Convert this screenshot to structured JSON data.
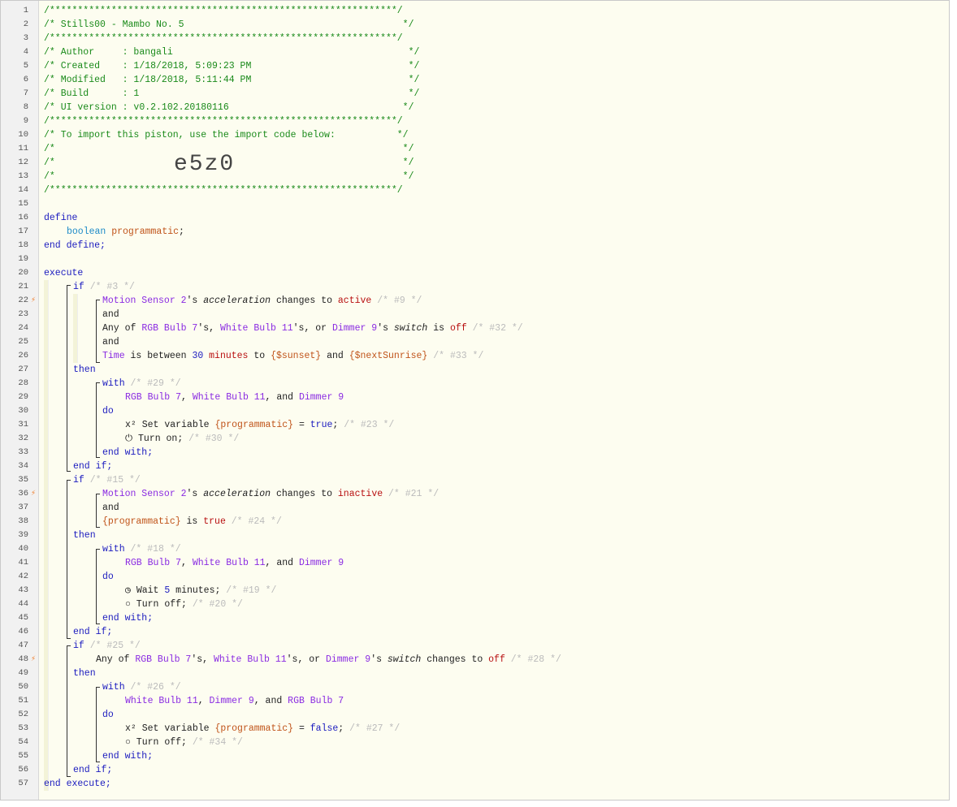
{
  "gutter": {
    "line_numbers": [
      "1",
      "2",
      "3",
      "4",
      "5",
      "6",
      "7",
      "8",
      "9",
      "10",
      "11",
      "12",
      "13",
      "14",
      "15",
      "16",
      "17",
      "18",
      "19",
      "20",
      "21",
      "22",
      "23",
      "24",
      "25",
      "26",
      "27",
      "28",
      "29",
      "30",
      "31",
      "32",
      "33",
      "34",
      "35",
      "36",
      "37",
      "38",
      "39",
      "40",
      "41",
      "42",
      "43",
      "44",
      "45",
      "46",
      "47",
      "48",
      "49",
      "50",
      "51",
      "52",
      "53",
      "54",
      "55",
      "56",
      "57"
    ],
    "trigger_icon": "⚡",
    "trigger_lines": [
      "22",
      "36",
      "48"
    ]
  },
  "header": {
    "border": "/**************************************************************/",
    "title_line": "/* Stills00 - Mambo No. 5                                       */",
    "author_line": "/* Author     : bangali                                          */",
    "created_line": "/* Created    : 1/18/2018, 5:09:23 PM                            */",
    "modified_line": "/* Modified   : 1/18/2018, 5:11:44 PM                            */",
    "build_line": "/* Build      : 1                                                */",
    "ui_version_line": "/* UI version : v0.2.102.20180116                               */",
    "import_line": "/* To import this piston, use the import code below:           */",
    "empty_line": "/*                                                              */",
    "import_code": "e5z0"
  },
  "code": {
    "define": "define",
    "boolean": "boolean",
    "programmatic": "programmatic",
    "semicolon": ";",
    "end_define": "end define;",
    "execute": "execute",
    "end_execute": "end execute;",
    "if": "if",
    "then": "then",
    "and": "and",
    "with": "with",
    "do": "do",
    "end_with": "end with;",
    "end_if": "end if;",
    "block1": {
      "if_comment": "/* #3 */",
      "c1_device": "Motion Sensor 2",
      "c1_s": "'s ",
      "c1_attr": "acceleration",
      "c1_op": " changes to ",
      "c1_val": "active",
      "c1_comment": "/* #9 */",
      "c2_any": "Any of ",
      "c2_d1": "RGB Bulb 7",
      "c2_s1": "'s, ",
      "c2_d2": "White Bulb 11",
      "c2_s2": "'s, or ",
      "c2_d3": "Dimmer 9",
      "c2_s3": "'s ",
      "c2_attr": "switch",
      "c2_op": " is ",
      "c2_val": "off",
      "c2_comment": "/* #32 */",
      "c3_time": "Time",
      "c3_op": " is between ",
      "c3_num": "30",
      "c3_units": " minutes",
      "c3_to": " to ",
      "c3_v1": "{$sunset}",
      "c3_and": " and ",
      "c3_v2": "{$nextSunrise}",
      "c3_comment": "/* #33 */",
      "with_comment": "/* #29 */",
      "dev1": "RGB Bulb 7",
      "sep1": ", ",
      "dev2": "White Bulb 11",
      "sep2": ", and ",
      "dev3": "Dimmer 9",
      "a1_icon": "x²",
      "a1_text": " Set variable ",
      "a1_var": "{programmatic}",
      "a1_eq": " = ",
      "a1_val": "true",
      "a1_semi": ";",
      "a1_comment": "/* #23 */",
      "a2_icon": "⏻",
      "a2_text": " Turn on;",
      "a2_comment": "/* #30 */"
    },
    "block2": {
      "if_comment": "/* #15 */",
      "c1_device": "Motion Sensor 2",
      "c1_s": "'s ",
      "c1_attr": "acceleration",
      "c1_op": " changes to ",
      "c1_val": "inactive",
      "c1_comment": "/* #21 */",
      "c2_var": "{programmatic}",
      "c2_op": " is ",
      "c2_val": "true",
      "c2_comment": "/* #24 */",
      "with_comment": "/* #18 */",
      "dev1": "RGB Bulb 7",
      "sep1": ", ",
      "dev2": "White Bulb 11",
      "sep2": ", and ",
      "dev3": "Dimmer 9",
      "a1_icon": "◷",
      "a1_text": " Wait ",
      "a1_num": "5",
      "a1_units": " minutes;",
      "a1_comment": "/* #19 */",
      "a2_icon": "○",
      "a2_text": " Turn off;",
      "a2_comment": "/* #20 */"
    },
    "block3": {
      "if_comment": "/* #25 */",
      "c1_any": "Any of ",
      "c1_d1": "RGB Bulb 7",
      "c1_s1": "'s, ",
      "c1_d2": "White Bulb 11",
      "c1_s2": "'s, or ",
      "c1_d3": "Dimmer 9",
      "c1_s3": "'s ",
      "c1_attr": "switch",
      "c1_op": " changes to ",
      "c1_val": "off",
      "c1_comment": "/* #28 */",
      "with_comment": "/* #26 */",
      "dev1": "White Bulb 11",
      "sep1": ", ",
      "dev2": "Dimmer 9",
      "sep2": ", and ",
      "dev3": "RGB Bulb 7",
      "a1_icon": "x²",
      "a1_text": " Set variable ",
      "a1_var": "{programmatic}",
      "a1_eq": " = ",
      "a1_val": "false",
      "a1_semi": ";",
      "a1_comment": "/* #27 */",
      "a2_icon": "○",
      "a2_text": " Turn off;",
      "a2_comment": "/* #34 */"
    }
  },
  "colors": {
    "comment_green": "#1a8a1a",
    "keyword_blue": "#1b1bbf",
    "device_purple": "#8a2be2",
    "variable_orange": "#c0541a",
    "value_red": "#b81010",
    "statement_comment_gray": "#bbbbbb",
    "trigger_orange": "#f08030"
  }
}
